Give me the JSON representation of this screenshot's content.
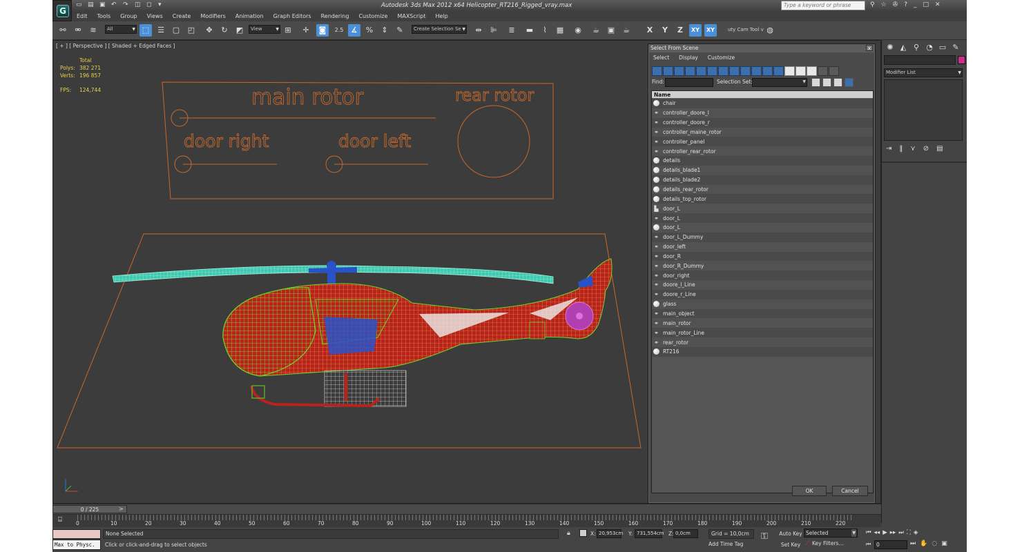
{
  "app": {
    "title": "Autodesk 3ds Max  2012 x64     Helicopter_RT216_Rigged_vray.max",
    "logo_letter": "G",
    "search_placeholder": "Type a keyword or phrase",
    "title_icons": [
      "binoculars-icon",
      "star-icon",
      "people-icon",
      "help-icon",
      "minimize-icon",
      "maximize-icon",
      "close-icon"
    ],
    "title_icon_glyphs": [
      "⚲",
      "☆",
      "✇",
      "?",
      "_",
      "□",
      "✕"
    ]
  },
  "menu": [
    "Edit",
    "Tools",
    "Group",
    "Views",
    "Create",
    "Modifiers",
    "Animation",
    "Graph Editors",
    "Rendering",
    "Customize",
    "MAXScript",
    "Help"
  ],
  "toolbar": {
    "filter_value": "All",
    "refcoord_value": "View",
    "named_selection_value": "Create Selection Se",
    "angle_snap": "2.5",
    "constraint_x": "X",
    "constraint_y": "Y",
    "constraint_z": "Z",
    "constraint_xy": "XY",
    "constraint_xy2": "XY",
    "cam_tool": "uty Cam Tool v"
  },
  "viewport": {
    "label": "[ + ] [ Perspective ] [ Shaded + Edged Faces ]",
    "stats_header": "Total",
    "polys_label": "Polys:",
    "polys_value": "382 271",
    "verts_label": "Verts:",
    "verts_value": "196 857",
    "fps_label": "FPS:",
    "fps_value": "124,744",
    "panel_labels": {
      "main_rotor": "main rotor",
      "rear_rotor": "rear rotor",
      "door_right": "door right",
      "door_left": "door left"
    },
    "colors": {
      "shape_orange": "#c8682c",
      "rotor_blade": "#3ec9b0",
      "hub_blue": "#2a52c8",
      "wire_green": "#6bd628",
      "body_red": "#b8231c"
    }
  },
  "dialog": {
    "title": "Select From Scene",
    "close": "x",
    "menu": [
      "Select",
      "Display",
      "Customize"
    ],
    "find_label": "Find:",
    "selection_set_label": "Selection Set:",
    "column_name": "Name",
    "items": [
      {
        "name": "chair",
        "icon": "sphere"
      },
      {
        "name": "controller_doore_l",
        "icon": "shape"
      },
      {
        "name": "controller_doore_r",
        "icon": "shape"
      },
      {
        "name": "controller_maine_rotor",
        "icon": "shape"
      },
      {
        "name": "controller_panel",
        "icon": "shape"
      },
      {
        "name": "controller_rear_rotor",
        "icon": "shape"
      },
      {
        "name": "details",
        "icon": "sphere"
      },
      {
        "name": "details_blade1",
        "icon": "sphere"
      },
      {
        "name": "details_blade2",
        "icon": "sphere"
      },
      {
        "name": "details_rear_rotor",
        "icon": "sphere"
      },
      {
        "name": "details_top_rotor",
        "icon": "sphere"
      },
      {
        "name": "door_L",
        "icon": "helper"
      },
      {
        "name": "door_L",
        "icon": "shape"
      },
      {
        "name": "door_L",
        "icon": "sphere"
      },
      {
        "name": "door_L_Dummy",
        "icon": "shape"
      },
      {
        "name": "door_left",
        "icon": "shape"
      },
      {
        "name": "door_R",
        "icon": "shape"
      },
      {
        "name": "door_R_Dummy",
        "icon": "shape"
      },
      {
        "name": "door_right",
        "icon": "shape"
      },
      {
        "name": "doore_l_Line",
        "icon": "shape"
      },
      {
        "name": "doore_r_Line",
        "icon": "shape"
      },
      {
        "name": "glass",
        "icon": "sphere"
      },
      {
        "name": "main_object",
        "icon": "shape"
      },
      {
        "name": "main_rotor",
        "icon": "shape"
      },
      {
        "name": "main_rotor_Line",
        "icon": "shape"
      },
      {
        "name": "rear_rotor",
        "icon": "shape"
      },
      {
        "name": "RT216",
        "icon": "sphere"
      }
    ],
    "ok_label": "OK",
    "cancel_label": "Cancel"
  },
  "command_panel": {
    "modifier_list": "Modifier List",
    "object_color": "#cc2d8a"
  },
  "timeline": {
    "slider_text": "0 / 225",
    "ticks": [
      "0",
      "10",
      "20",
      "30",
      "40",
      "50",
      "60",
      "70",
      "80",
      "90",
      "100",
      "110",
      "120",
      "130",
      "140",
      "150",
      "160",
      "170",
      "180",
      "190",
      "200",
      "210",
      "220"
    ]
  },
  "status": {
    "maxscript": "Max to Physc.",
    "selection_text": "None Selected",
    "prompt": "Click or click-and-drag to select objects",
    "x_label": "X:",
    "x_value": "20,953cm",
    "y_label": "Y:",
    "y_value": "731,554cm",
    "z_label": "Z:",
    "z_value": "0,0cm",
    "grid": "Grid = 10,0cm",
    "add_time_tag": "Add Time Tag",
    "auto_key": "Auto Key",
    "set_key": "Set Key",
    "selected_value": "Selected",
    "key_filters": "Key Filters...",
    "frame_value": "0"
  }
}
